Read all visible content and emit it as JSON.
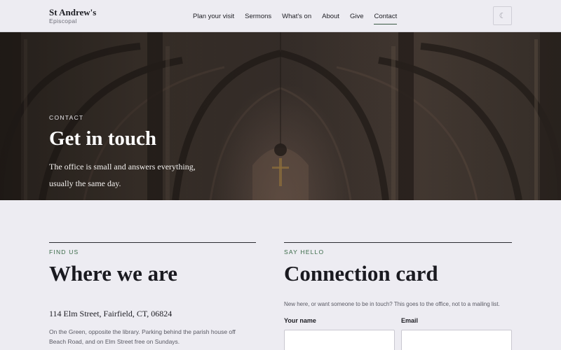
{
  "header": {
    "brand_name": "St Andrew's",
    "brand_sub": "Episcopal",
    "nav": [
      {
        "label": "Plan your visit",
        "active": false
      },
      {
        "label": "Sermons",
        "active": false
      },
      {
        "label": "What's on",
        "active": false
      },
      {
        "label": "About",
        "active": false
      },
      {
        "label": "Give",
        "active": false
      },
      {
        "label": "Contact",
        "active": true
      }
    ],
    "theme_toggle_icon": "moon-icon",
    "theme_toggle_glyph": "☾"
  },
  "hero": {
    "eyebrow": "CONTACT",
    "title": "Get in touch",
    "text": "The office is small and answers everything, usually the same day."
  },
  "find_us": {
    "eyebrow": "FIND US",
    "title": "Where we are",
    "address": "114 Elm Street, Fairfield, CT, 06824",
    "directions": "On the Green, opposite the library. Parking behind the parish house off Beach Road, and on Elm Street free on Sundays."
  },
  "connection_card": {
    "eyebrow": "SAY HELLO",
    "title": "Connection card",
    "intro": "New here, or want someone to be in touch? This goes to the office, not to a mailing list.",
    "name_label": "Your name",
    "name_value": "",
    "email_label": "Email",
    "email_value": ""
  },
  "colors": {
    "background": "#edecf2",
    "accent_green": "#3a6a48",
    "text": "#1e1e24"
  }
}
